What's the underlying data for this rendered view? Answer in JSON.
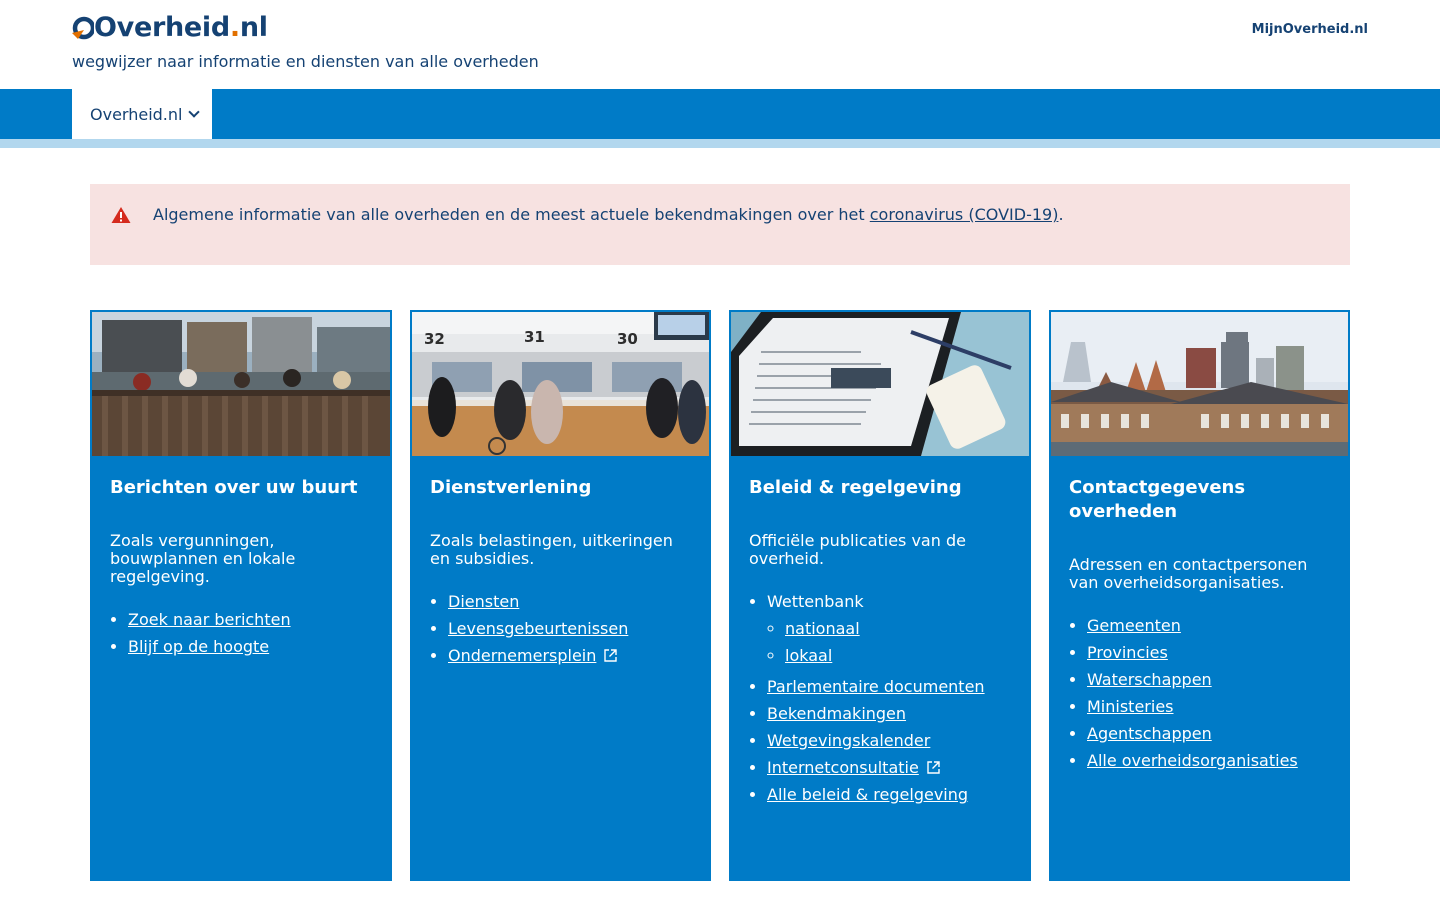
{
  "header": {
    "logo_main": "Overheid",
    "logo_dot": ".",
    "logo_tld": "nl",
    "tagline": "wegwijzer naar informatie en diensten van alle overheden",
    "mijn_link": "MijnOverheid.nl"
  },
  "nav": {
    "tab_label": "Overheid.nl"
  },
  "alert": {
    "text_before": "Algemene informatie van alle overheden en de meest actuele bekendmakingen over het ",
    "link": "coronavirus (COVID-19)",
    "text_after": "."
  },
  "cards": [
    {
      "title": "Berichten over uw buurt",
      "description": "Zoals vergunningen, bouwplannen en lokale regelgeving.",
      "links": [
        "Zoek naar berichten",
        "Blijf op de hoogte"
      ]
    },
    {
      "title": "Dienstverlening",
      "description": "Zoals belastingen, uitkeringen en subsidies.",
      "links": [
        "Diensten",
        "Levensgebeurtenissen",
        "Ondernemersplein"
      ]
    },
    {
      "title": "Beleid & regelgeving",
      "description": "Officiële publicaties van de overheid.",
      "wettenbank": "Wettenbank",
      "wettenbank_sub": [
        "nationaal",
        "lokaal"
      ],
      "links": [
        "Parlementaire documenten",
        "Bekendmakingen",
        "Wetgevingskalender",
        "Internetconsultatie",
        "Alle beleid & regelgeving"
      ]
    },
    {
      "title": "Contactgegevens overheden",
      "description": "Adressen en contactpersonen van overheidsorganisaties.",
      "links": [
        "Gemeenten",
        "Provincies",
        "Waterschappen",
        "Ministeries",
        "Agentschappen",
        "Alle overheidsorganisaties"
      ]
    }
  ],
  "image_numbers": [
    "32",
    "31",
    "30"
  ],
  "colors": {
    "brand_blue": "#007bc7",
    "dark_blue": "#154273",
    "light_blue": "#b2d7ee",
    "alert_bg": "#f7e2e1",
    "alert_red": "#d52b1e",
    "orange": "#e17000"
  }
}
